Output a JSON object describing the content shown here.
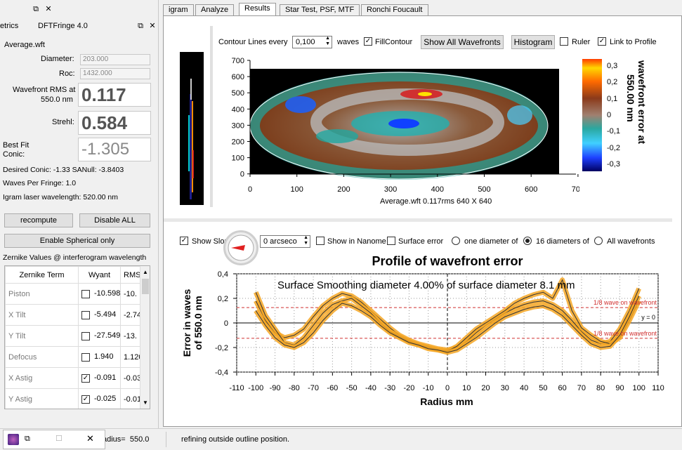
{
  "left_dock": {
    "title_left": "etrics",
    "title_main": "DFTFringe 4.0",
    "filename": "Average.wft",
    "diameter_label": "Diameter:",
    "diameter_value": "203.000",
    "roc_label": "Roc:",
    "roc_value": "1432.000",
    "wavefront_rms_label_1": "Wavefront RMS at",
    "wavefront_rms_label_2": "550.0 nm",
    "wavefront_rms_value": "0.117",
    "strehl_label": "Strehl:",
    "strehl_value": "0.584",
    "bestfit_label_1": "Best Fit",
    "bestfit_label_2": "Conic:",
    "bestfit_value": "-1.305",
    "desired_conic": "Desired Conic:  -1.33 SANull: -3.8403",
    "waves_per_fringe": "Waves Per Fringe: 1.0",
    "igram_wavelength": "Igram laser wavelength: 520.00 nm",
    "recompute_label": "recompute",
    "disable_all_label": "Disable ALL",
    "enable_spherical_label": "Enable Spherical only",
    "zernike_header": "Zernike Values @ interferogram wavelength",
    "zernike_columns": [
      "Zernike Term",
      "Wyant",
      "RMS"
    ],
    "zernike_rows": [
      {
        "name": "Piston",
        "checked": false,
        "wyant": "-10.598",
        "rms": "-10."
      },
      {
        "name": "X Tilt",
        "checked": false,
        "wyant": "-5.494",
        "rms": "-2.74"
      },
      {
        "name": "Y Tilt",
        "checked": false,
        "wyant": "-27.549",
        "rms": "-13."
      },
      {
        "name": "Defocus",
        "checked": false,
        "wyant": "1.940",
        "rms": "1.120"
      },
      {
        "name": "X Astig",
        "checked": true,
        "wyant": "-0.091",
        "rms": "-0.03"
      },
      {
        "name": "Y Astig",
        "checked": true,
        "wyant": "-0.025",
        "rms": "-0.01"
      }
    ]
  },
  "tabs": [
    "igram",
    "Analyze",
    "Results",
    "Star Test, PSF, MTF",
    "Ronchi  Foucault"
  ],
  "active_tab": "Results",
  "contour_controls": {
    "contour_label": "Contour Lines every",
    "contour_value": "0,100",
    "waves_label": "waves",
    "fill_contour_label": "FillContour",
    "fill_contour_checked": true,
    "show_all_label": "Show All Wavefronts",
    "histogram_label": "Histogram",
    "ruler_label": "Ruler",
    "ruler_checked": false,
    "link_profile_label": "Link to Profile",
    "link_profile_checked": true
  },
  "contour_plot": {
    "x_ticks": [
      "0",
      "100",
      "200",
      "300",
      "400",
      "500",
      "600",
      "700"
    ],
    "y_ticks": [
      "700",
      "600",
      "500",
      "400",
      "300",
      "200",
      "100",
      "0"
    ],
    "caption": "Average.wft  0.117rms 640 X 640",
    "colorbar_ticks": [
      "0,3",
      "0,2",
      "0,1",
      "0",
      "-0,1",
      "-0,2",
      "-0,3"
    ],
    "colorbar_label_1": "wavefront error at",
    "colorbar_label_2": "550.00 nm"
  },
  "profile_controls": {
    "show_slope_label": "Show Slop",
    "show_slope_checked": true,
    "slope_value": "0 arcseco",
    "show_nanometers_label": "Show in Nanome",
    "surface_error_label": "Surface error",
    "one_diameter_label": "one diameter of",
    "sixteen_diameters_label": "16 diameters of",
    "all_wavefronts_label": "All wavefronts",
    "selected": "16 diameters of"
  },
  "chart_data": {
    "type": "line",
    "title": "Profile of wavefront error",
    "xlabel": "Radius mm",
    "ylabel": "Error in waves of  550.0 nm",
    "ylabel_1": "Error in waves",
    "ylabel_2": "of  550.0 nm",
    "xlim": [
      -110,
      110
    ],
    "ylim": [
      -0.4,
      0.4
    ],
    "x_ticks": [
      "-110",
      "-100",
      "-90",
      "-80",
      "-70",
      "-60",
      "-50",
      "-40",
      "-30",
      "-20",
      "-10",
      "0",
      "10",
      "20",
      "30",
      "40",
      "50",
      "60",
      "70",
      "80",
      "90",
      "100",
      "110"
    ],
    "y_ticks": [
      "0,4",
      "0,2",
      "0",
      "-0,2",
      "-0,4"
    ],
    "annotation": "Surface Smoothing diameter   4.00% of surface diameter     8.1 mm",
    "ref_labels": {
      "top": "1/8 wave on wavefront",
      "zero": "y = 0",
      "bottom": "1/8 wave on wavefront"
    },
    "ref_lines": [
      0.125,
      0,
      -0.125
    ],
    "series": [
      {
        "x": [
          -100,
          -95,
          -90,
          -85,
          -80,
          -75,
          -70,
          -65,
          -60,
          -55,
          -50,
          -45,
          -40,
          -35,
          -30,
          -25,
          -20,
          -15,
          -10,
          -5,
          0,
          5,
          10,
          15,
          20,
          25,
          30,
          35,
          40,
          45,
          50,
          55,
          60,
          65,
          70,
          75,
          80,
          85,
          90,
          95,
          100
        ],
        "values": [
          0.18,
          0.02,
          -0.08,
          -0.12,
          -0.1,
          -0.05,
          0.05,
          0.14,
          0.2,
          0.24,
          0.22,
          0.17,
          0.1,
          0.03,
          -0.04,
          -0.1,
          -0.14,
          -0.17,
          -0.19,
          -0.21,
          -0.22,
          -0.2,
          -0.15,
          -0.08,
          -0.02,
          0.03,
          0.08,
          0.12,
          0.15,
          0.17,
          0.18,
          0.15,
          0.1,
          0.02,
          -0.07,
          -0.14,
          -0.17,
          -0.15,
          -0.05,
          0.1,
          0.28
        ]
      },
      {
        "x": [
          -100,
          -95,
          -90,
          -85,
          -80,
          -75,
          -70,
          -65,
          -60,
          -55,
          -50,
          -45,
          -40,
          -35,
          -30,
          -25,
          -20,
          -15,
          -10,
          -5,
          0,
          5,
          10,
          15,
          20,
          25,
          30,
          35,
          40,
          45,
          50,
          55,
          60,
          65,
          70,
          75,
          80,
          85,
          90,
          95,
          100
        ],
        "values": [
          0.25,
          0.06,
          -0.05,
          -0.16,
          -0.18,
          -0.12,
          -0.02,
          0.08,
          0.15,
          0.18,
          0.2,
          0.14,
          0.08,
          0.0,
          -0.07,
          -0.11,
          -0.15,
          -0.18,
          -0.2,
          -0.22,
          -0.23,
          -0.19,
          -0.12,
          -0.05,
          0.0,
          0.05,
          0.1,
          0.16,
          0.2,
          0.23,
          0.25,
          0.2,
          0.35,
          0.1,
          -0.04,
          -0.1,
          -0.15,
          -0.17,
          -0.12,
          0.02,
          0.18
        ]
      },
      {
        "x": [
          -100,
          -95,
          -90,
          -85,
          -80,
          -75,
          -70,
          -65,
          -60,
          -55,
          -50,
          -45,
          -40,
          -35,
          -30,
          -25,
          -20,
          -15,
          -10,
          -5,
          0,
          5,
          10,
          15,
          20,
          25,
          30,
          35,
          40,
          45,
          50,
          55,
          60,
          65,
          70,
          75,
          80,
          85,
          90,
          95,
          100
        ],
        "values": [
          0.1,
          -0.02,
          -0.12,
          -0.18,
          -0.2,
          -0.16,
          -0.08,
          0.02,
          0.1,
          0.16,
          0.14,
          0.1,
          0.05,
          -0.02,
          -0.08,
          -0.12,
          -0.16,
          -0.18,
          -0.21,
          -0.22,
          -0.24,
          -0.22,
          -0.17,
          -0.12,
          -0.06,
          0.0,
          0.05,
          0.08,
          0.11,
          0.13,
          0.14,
          0.11,
          0.06,
          -0.02,
          -0.1,
          -0.17,
          -0.2,
          -0.19,
          -0.1,
          0.05,
          0.22
        ]
      }
    ]
  }
}
